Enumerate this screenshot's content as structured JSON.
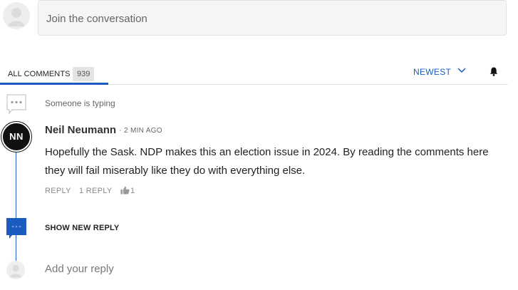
{
  "composer": {
    "placeholder": "Join the conversation"
  },
  "tabs": {
    "all_label": "ALL COMMENTS",
    "count": "939"
  },
  "sort": {
    "label": "NEWEST"
  },
  "typing": {
    "text": "Someone is typing"
  },
  "comment": {
    "author_initials": "NN",
    "author": "Neil Neumann",
    "separator": "·",
    "time": "2 MIN AGO",
    "body": "Hopefully the Sask. NDP makes this an election issue in 2024. By reading the comments here they will fail miserably like they do with everything else.",
    "reply_label": "REPLY",
    "replies_label": "1 REPLY",
    "likes": "1"
  },
  "thread": {
    "show_new_label": "SHOW NEW REPLY"
  },
  "reply_composer": {
    "placeholder": "Add your reply"
  },
  "colors": {
    "accent": "#1a5bbf",
    "avatar_bg": "#111111"
  },
  "icons": [
    "avatar-placeholder-icon",
    "chevron-down-icon",
    "bell-icon",
    "typing-bubble-icon",
    "thumbs-up-icon",
    "new-reply-bubble-icon"
  ]
}
